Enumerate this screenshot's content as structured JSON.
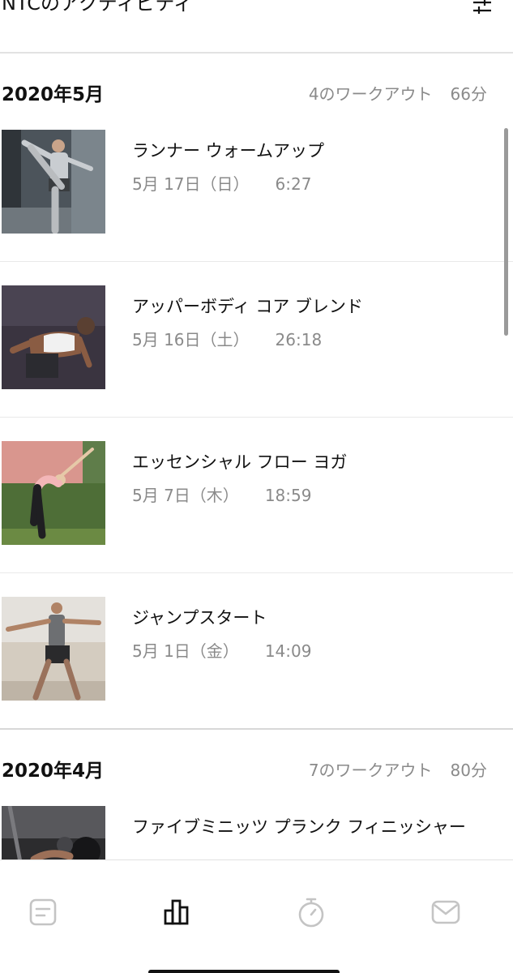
{
  "header": {
    "title": "NTCのアクティビティ",
    "filter_icon": "sliders-icon"
  },
  "sections": [
    {
      "month": "2020年5月",
      "workout_count": "4のワークアウト",
      "total_minutes": "66分",
      "workouts": [
        {
          "name": "ランナー ウォームアップ",
          "date": "5月 17日（日）",
          "duration": "6:27"
        },
        {
          "name": "アッパーボディ コア ブレンド",
          "date": "5月 16日（土）",
          "duration": "26:18"
        },
        {
          "name": "エッセンシャル フロー ヨガ",
          "date": "5月 7日（木）",
          "duration": "18:59"
        },
        {
          "name": "ジャンプスタート",
          "date": "5月 1日（金）",
          "duration": "14:09"
        }
      ]
    },
    {
      "month": "2020年4月",
      "workout_count": "7のワークアウト",
      "total_minutes": "80分",
      "workouts": [
        {
          "name": "ファイブミニッツ プランク フィニッシャー",
          "date": "",
          "duration": ""
        }
      ]
    }
  ],
  "tab_bar": {
    "tabs": [
      {
        "icon": "feed-icon",
        "active": false
      },
      {
        "icon": "activity-chart-icon",
        "active": true
      },
      {
        "icon": "stopwatch-icon",
        "active": false
      },
      {
        "icon": "inbox-icon",
        "active": false
      }
    ]
  },
  "colors": {
    "text": "#111111",
    "secondary_text": "#8a8a8a",
    "divider": "#e2e2e2",
    "inactive_icon": "#c4c4c4"
  }
}
